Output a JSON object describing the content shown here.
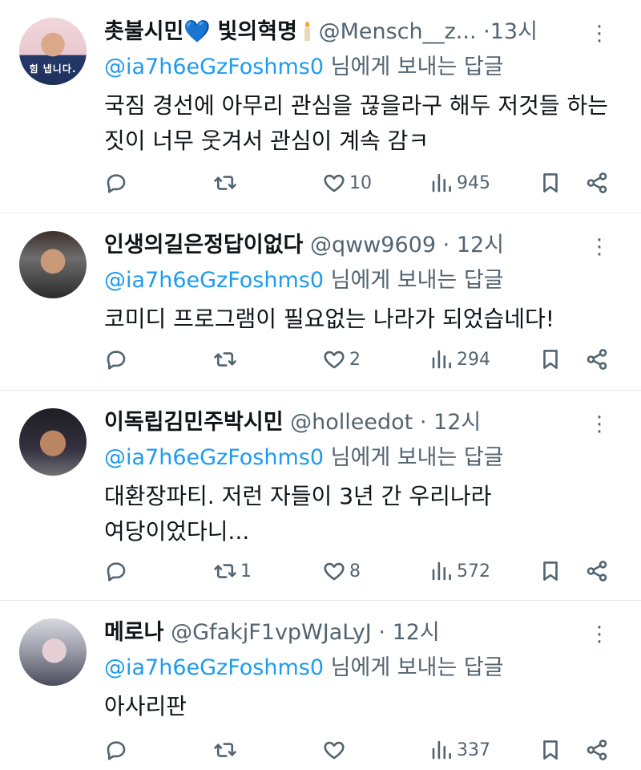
{
  "reply_to_suffix": "님에게 보내는 답글",
  "tweets": [
    {
      "name": "촛불시민",
      "name_suffix": "빛의혁명",
      "handle": "@Mensch__z...",
      "time": "13시",
      "reply_to": "@ia7h6eGzFoshms0",
      "text_lines": [
        "국짐 경선에 아무리 관심을 끊을라구 해두 저것들 하는",
        "짓이 너무 웃겨서 관심이 계속 감ㅋ"
      ],
      "avatar_text": "힘 냅니다.",
      "retweets": "",
      "likes": "10",
      "views": "945"
    },
    {
      "name": "인생의길은정답이없다",
      "handle": "@qww9609",
      "time": "12시",
      "reply_to": "@ia7h6eGzFoshms0",
      "text_lines": [
        "코미디 프로그램이 필요없는 나라가 되었습네다!"
      ],
      "retweets": "",
      "likes": "2",
      "views": "294"
    },
    {
      "name": "이독립김민주박시민",
      "handle": "@holleedot",
      "time": "12시",
      "reply_to": "@ia7h6eGzFoshms0",
      "text_lines": [
        "대환장파티. 저런 자들이 3년 간 우리나라",
        "여당이었다니..."
      ],
      "retweets": "1",
      "likes": "8",
      "views": "572"
    },
    {
      "name": "메로나",
      "handle": "@GfakjF1vpWJaLyJ",
      "time": "12시",
      "reply_to": "@ia7h6eGzFoshms0",
      "text_lines": [
        "아사리판"
      ],
      "retweets": "",
      "likes": "",
      "views": "337"
    }
  ]
}
